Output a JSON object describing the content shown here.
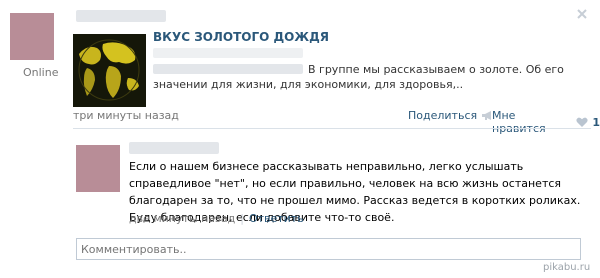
{
  "status": {
    "online": "Online"
  },
  "post": {
    "group_title": "ВКУС ЗОЛОТОГО ДОЖДЯ",
    "snippet_line1_visible": "В группе мы рассказываем о золоте. Об его",
    "snippet_line2": "значении для жизни, для экономики, для здоровья,..",
    "time": "три минуты назад",
    "share_label": "Поделиться",
    "like_label": "Мне нравится",
    "like_count": "1"
  },
  "comment": {
    "text": "Если о нашем бизнесе рассказывать неправильно, легко услышать справедливое \"нет\", но если правильно, человек на всю жизнь останется благодарен за то, что не прошел мимо. Рассказ ведется в коротких роликах. Буду благодарен, если добавите что-то своё.",
    "time": "две минуты назад",
    "separator": "|",
    "reply_label": "Ответить"
  },
  "comment_input": {
    "placeholder": "Комментировать.."
  },
  "icons": {
    "close": "close-icon",
    "megaphone": "megaphone-icon",
    "heart": "heart-icon"
  },
  "watermark": "pikabu.ru",
  "colors": {
    "link_blue": "#2b587a",
    "grey_text": "#777777",
    "divider": "#dae1e8",
    "input_border": "#c0cad5"
  }
}
